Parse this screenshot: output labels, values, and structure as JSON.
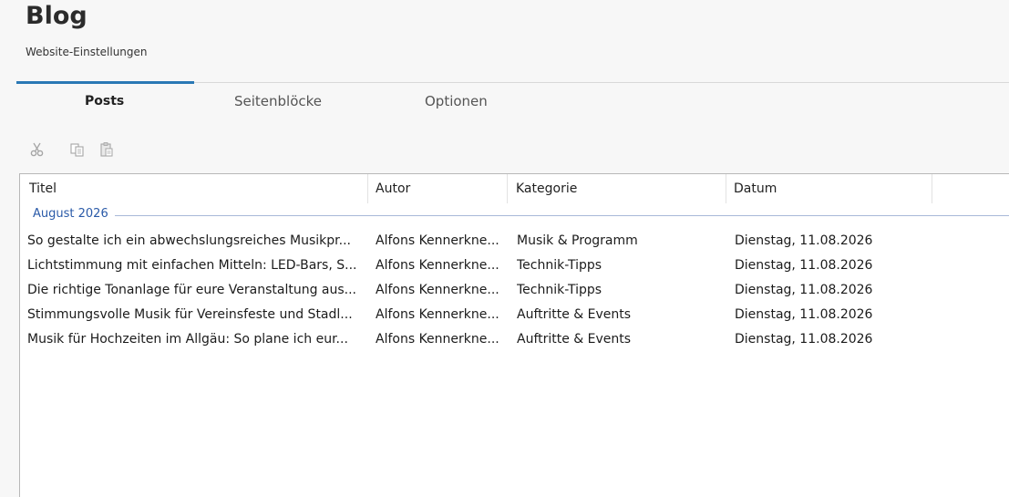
{
  "header": {
    "title": "Blog",
    "subtitle": "Website-Einstellungen"
  },
  "tabs": [
    {
      "label": "Posts",
      "active": true
    },
    {
      "label": "Seitenblöcke",
      "active": false
    },
    {
      "label": "Optionen",
      "active": false
    }
  ],
  "toolbar": {
    "icons": [
      "cut-icon",
      "copy-icon",
      "paste-icon"
    ]
  },
  "colors": {
    "accent": "#2a78b5",
    "group_text": "#2a5aa8"
  },
  "table": {
    "columns": [
      "Titel",
      "Autor",
      "Kategorie",
      "Datum"
    ],
    "group_label": "August 2026",
    "rows": [
      {
        "title": "So gestalte ich ein abwechslungsreiches Musikpr...",
        "author": "Alfons Kennerkne...",
        "category": "Musik & Programm",
        "date": "Dienstag, 11.08.2026"
      },
      {
        "title": "Lichtstimmung mit einfachen Mitteln: LED-Bars, S...",
        "author": "Alfons Kennerkne...",
        "category": "Technik-Tipps",
        "date": "Dienstag, 11.08.2026"
      },
      {
        "title": "Die richtige Tonanlage für eure Veranstaltung aus...",
        "author": "Alfons Kennerkne...",
        "category": "Technik-Tipps",
        "date": "Dienstag, 11.08.2026"
      },
      {
        "title": "Stimmungsvolle Musik für Vereinsfeste und Stadl...",
        "author": "Alfons Kennerkne...",
        "category": "Auftritte & Events",
        "date": "Dienstag, 11.08.2026"
      },
      {
        "title": "Musik für Hochzeiten im Allgäu: So plane ich eur...",
        "author": "Alfons Kennerkne...",
        "category": "Auftritte & Events",
        "date": "Dienstag, 11.08.2026"
      }
    ]
  }
}
